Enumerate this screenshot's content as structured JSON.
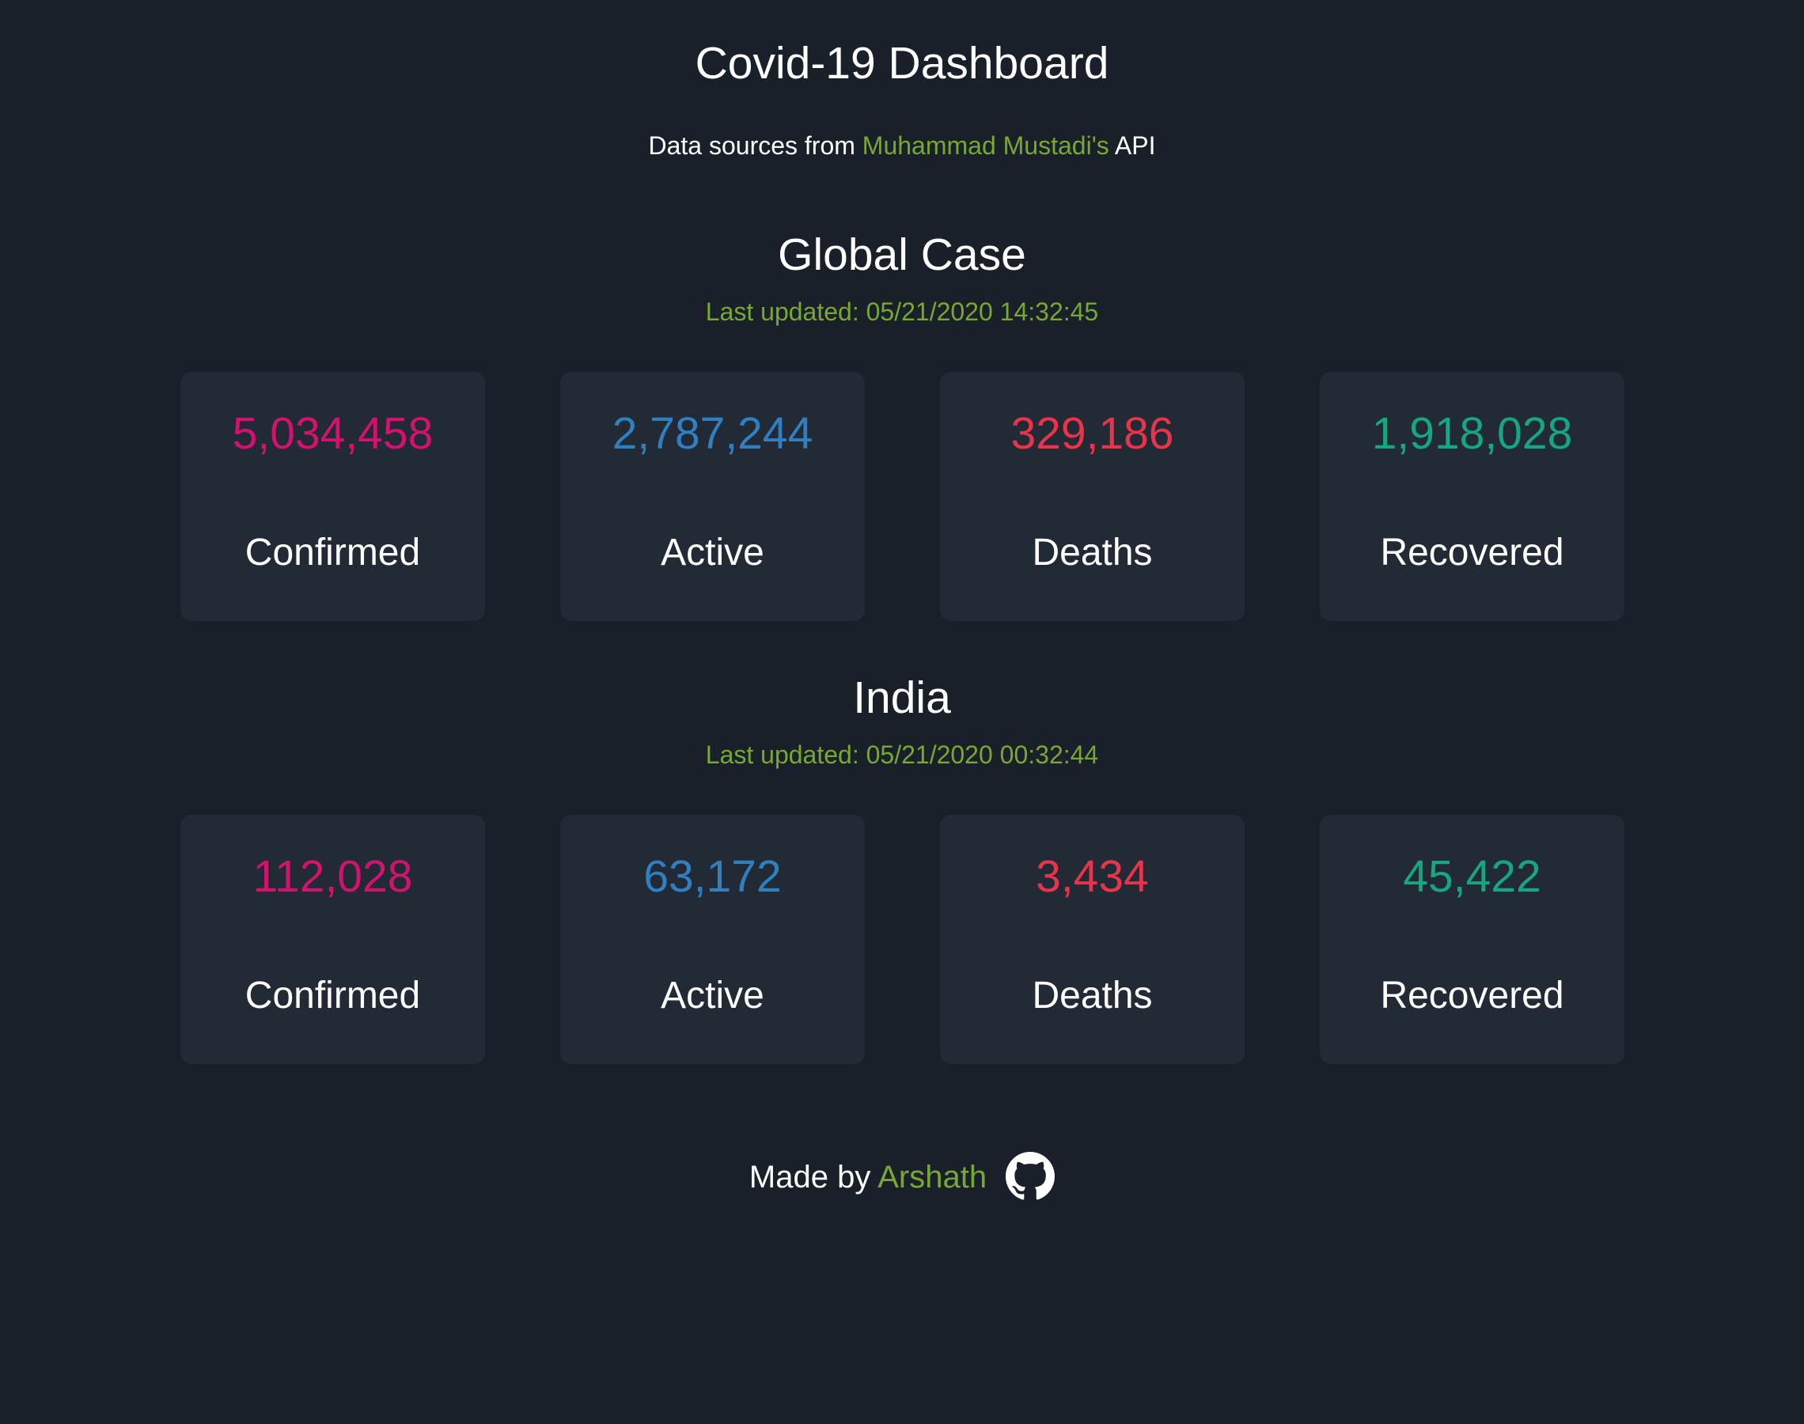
{
  "header": {
    "title": "Covid-19 Dashboard",
    "subtitle_prefix": "Data sources from ",
    "subtitle_link": "Muhammad Mustadi's",
    "subtitle_suffix": " API"
  },
  "colors": {
    "background": "#1a202a",
    "card": "#222a35",
    "accent": "#76a832",
    "confirmed": "#d1126f",
    "active": "#2f7fc1",
    "deaths": "#e8344a",
    "recovered": "#15a77f"
  },
  "global": {
    "title": "Global Case",
    "updated": "Last updated: 05/21/2020 14:32:45",
    "stats": [
      {
        "value": "5,034,458",
        "label": "Confirmed"
      },
      {
        "value": "2,787,244",
        "label": "Active"
      },
      {
        "value": "329,186",
        "label": "Deaths"
      },
      {
        "value": "1,918,028",
        "label": "Recovered"
      }
    ]
  },
  "india": {
    "title": "India",
    "updated": "Last updated: 05/21/2020 00:32:44",
    "stats": [
      {
        "value": "112,028",
        "label": "Confirmed"
      },
      {
        "value": "63,172",
        "label": "Active"
      },
      {
        "value": "3,434",
        "label": "Deaths"
      },
      {
        "value": "45,422",
        "label": "Recovered"
      }
    ]
  },
  "footer": {
    "prefix": "Made by ",
    "author": "Arshath",
    "icon": "github-icon"
  }
}
